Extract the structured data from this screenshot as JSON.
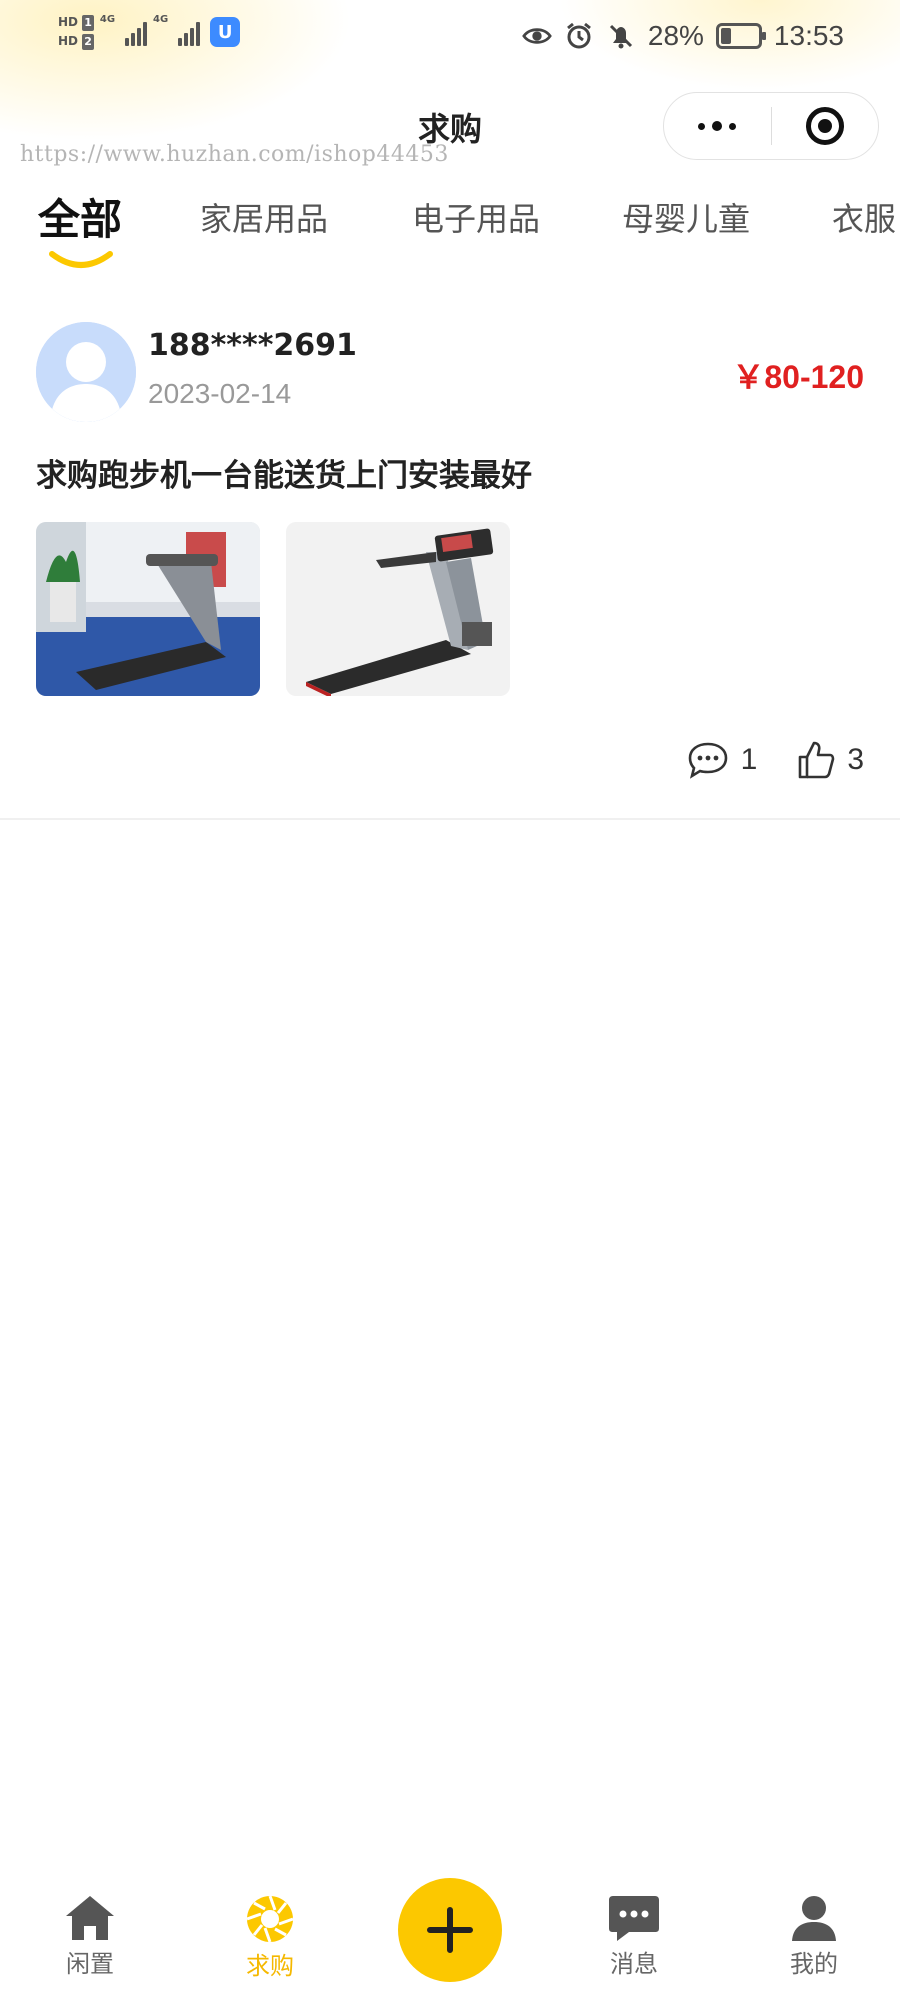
{
  "status_bar": {
    "hd1": "HD",
    "hd1_num": "1",
    "hd2": "HD",
    "hd2_num": "2",
    "net1": "4G",
    "net2": "4G",
    "app_badge": "U",
    "battery_text": "28%",
    "battery_level": 0.28,
    "time": "13:53"
  },
  "header": {
    "title": "求购",
    "watermark": "https://www.huzhan.com/ishop44453"
  },
  "tabs": {
    "items": [
      "全部",
      "家居用品",
      "电子用品",
      "母婴儿童",
      "衣服"
    ],
    "active_index": 0
  },
  "post": {
    "username": "188****2691",
    "date": "2023-02-14",
    "price": "￥80-120",
    "title": "求购跑步机一台能送货上门安装最好",
    "comment_count": "1",
    "like_count": "3"
  },
  "bottom_nav": {
    "items": [
      {
        "label": "闲置",
        "icon": "home-icon"
      },
      {
        "label": "求购",
        "icon": "aperture-icon"
      },
      {
        "label": "",
        "icon": "plus-icon"
      },
      {
        "label": "消息",
        "icon": "chat-icon"
      },
      {
        "label": "我的",
        "icon": "user-icon"
      }
    ],
    "active_index": 1
  },
  "colors": {
    "accent": "#fcc800",
    "active_label": "#f5b800",
    "price": "#e02020"
  }
}
